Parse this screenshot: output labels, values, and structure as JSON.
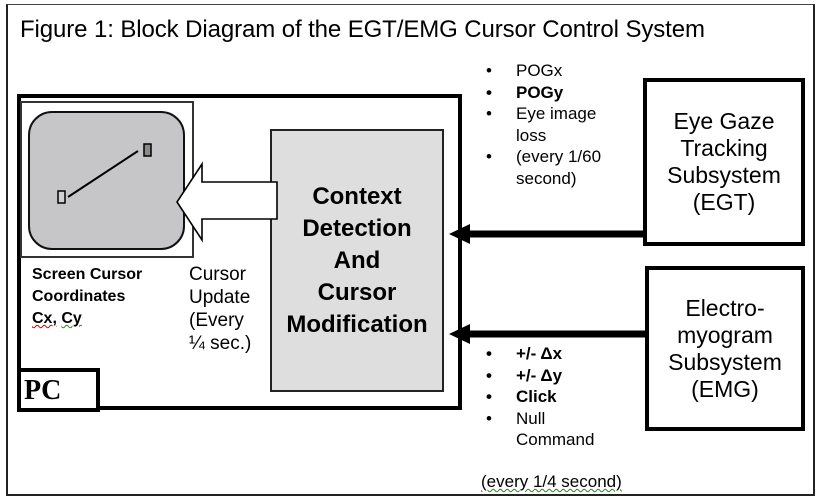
{
  "title": "Figure 1: Block Diagram of the EGT/EMG Cursor Control System",
  "pc": {
    "label": "PC",
    "screen_caption": [
      "Screen Cursor",
      "Coordinates"
    ],
    "screen_coords_x": "Cx,",
    "screen_coords_y": "Cy",
    "cursor_update": "Cursor\nUpdate\n(Every\n¼ sec.)"
  },
  "context_block": {
    "label": "Context\nDetection\nAnd\nCursor\nModification"
  },
  "egt": {
    "label": "Eye Gaze\nTracking\nSubsystem\n(EGT)",
    "outputs": [
      {
        "text": "POGx",
        "bold": false
      },
      {
        "text": "POGy",
        "bold": true
      },
      {
        "text": "Eye image\nloss",
        "bold": false
      },
      {
        "text": "(every 1/60\nsecond)",
        "bold": false
      }
    ]
  },
  "emg": {
    "label": "Electro-\nmyogram\nSubsystem\n(EMG)",
    "outputs": [
      {
        "text": "+/- Δx",
        "bold": true
      },
      {
        "text": "+/- Δy",
        "bold": true
      },
      {
        "text": "Click",
        "bold": true
      },
      {
        "text": "Null\nCommand",
        "bold": false
      }
    ],
    "rate": "(every 1/4 second)"
  },
  "bullet_glyph": "•",
  "colors": {
    "screen_fill": "#c6c6c8",
    "context_fill": "#dedede",
    "stroke": "#000000"
  }
}
